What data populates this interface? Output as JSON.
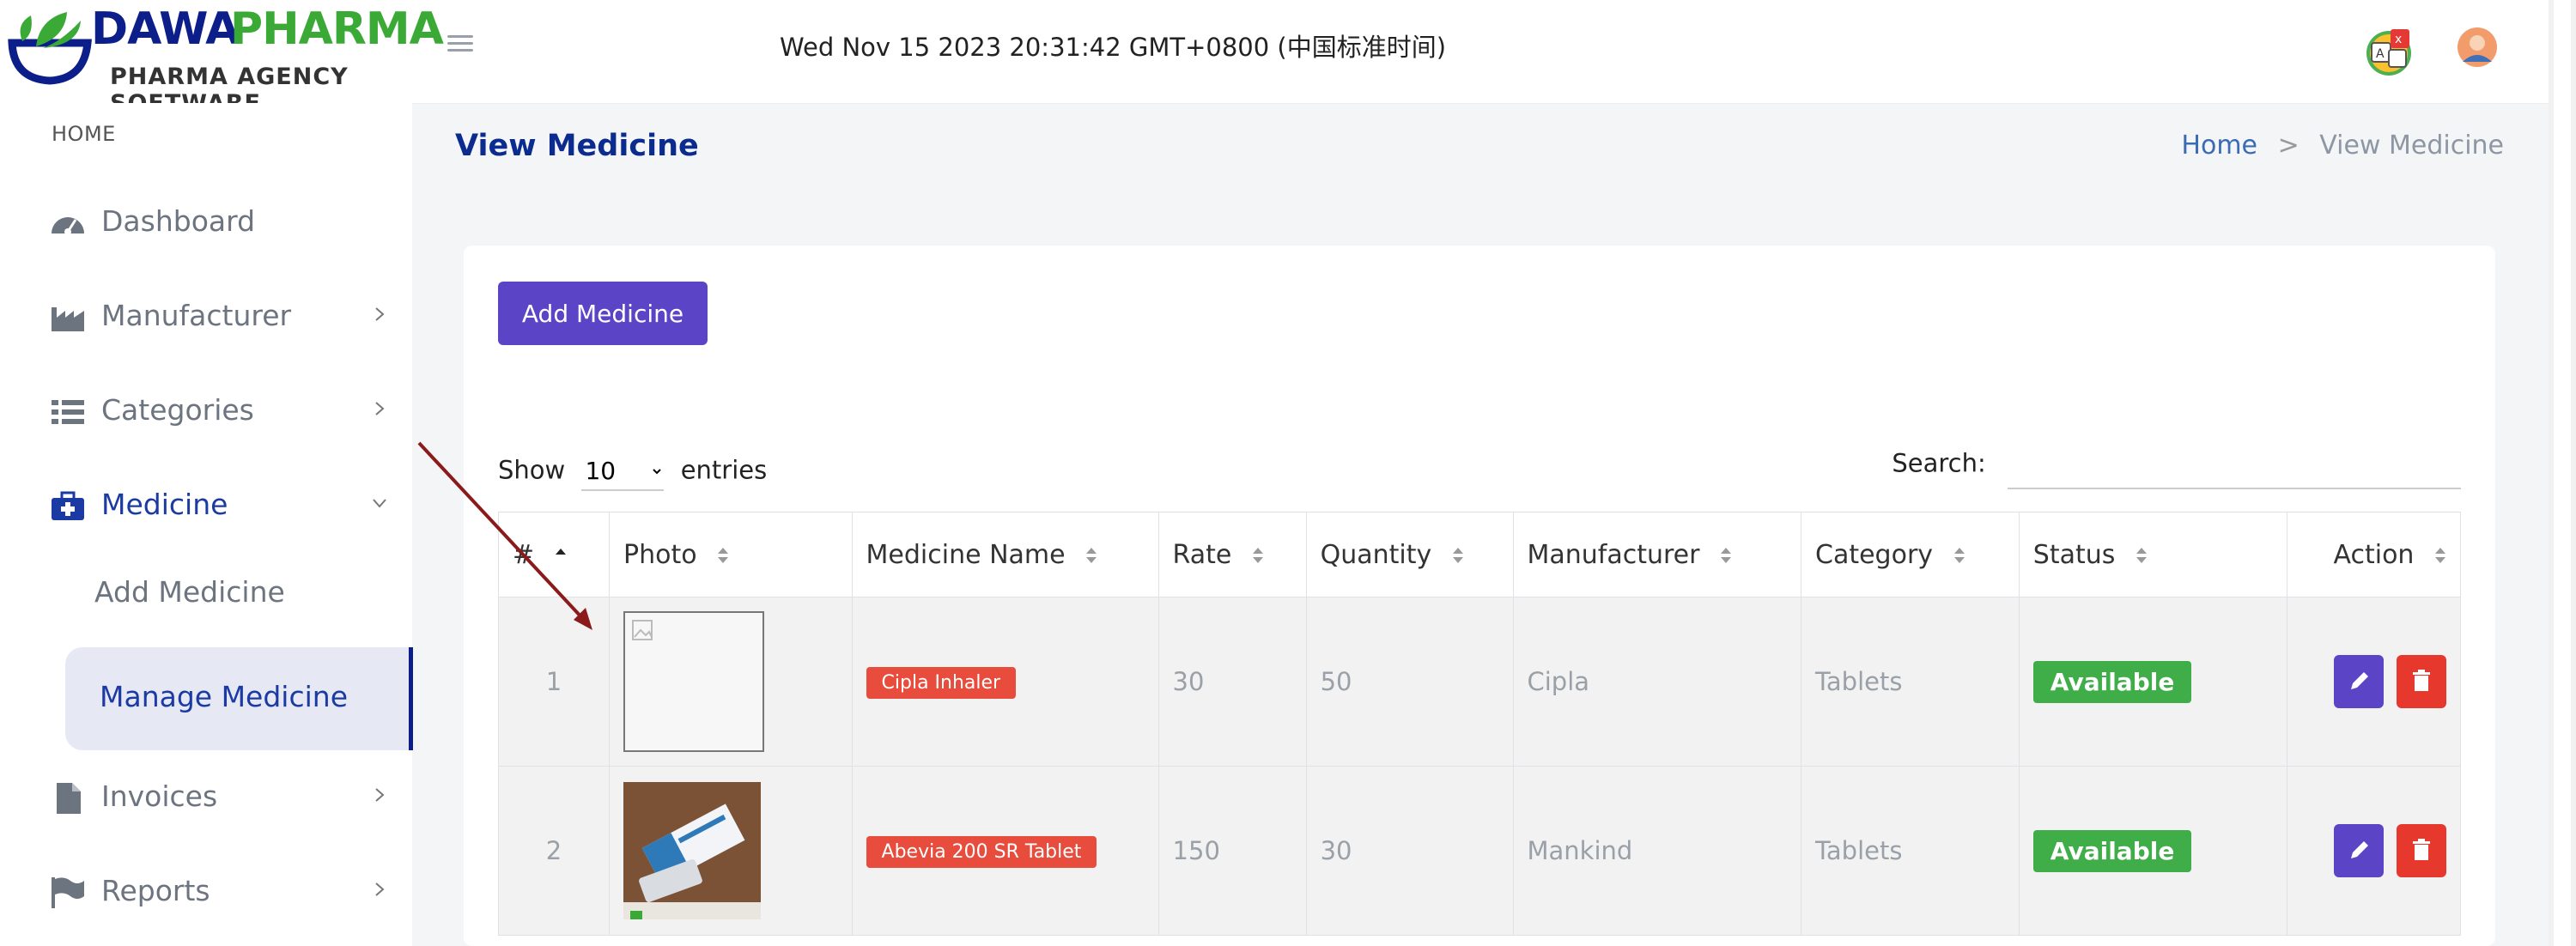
{
  "header": {
    "brand_primary": "DAWA",
    "brand_secondary": "PHARMA",
    "brand_tagline": "PHARMA AGENCY SOFTWARE",
    "datetime": "Wed Nov 15 2023 20:31:42 GMT+0800 (中国标准时间)",
    "menu_icon": "hamburger-icon",
    "language_icon": "translate-icon",
    "avatar_icon": "user-avatar"
  },
  "sidebar": {
    "heading": "HOME",
    "items": [
      {
        "label": "Dashboard",
        "icon": "dashboard-icon"
      },
      {
        "label": "Manufacturer",
        "icon": "factory-icon"
      },
      {
        "label": "Categories",
        "icon": "list-icon"
      },
      {
        "label": "Medicine",
        "icon": "medkit-icon"
      },
      {
        "label": "Invoices",
        "icon": "file-icon"
      },
      {
        "label": "Reports",
        "icon": "flag-icon"
      }
    ],
    "medicine_sub": [
      {
        "label": "Add Medicine"
      },
      {
        "label": "Manage Medicine"
      }
    ]
  },
  "page": {
    "title": "View Medicine",
    "breadcrumb_home": "Home",
    "breadcrumb_sep": ">",
    "breadcrumb_current": "View Medicine"
  },
  "toolbar": {
    "add_label": "Add Medicine",
    "show_label": "Show",
    "entries_value": "10",
    "entries_label": "entries",
    "search_label": "Search:"
  },
  "table": {
    "columns": [
      "#",
      "Photo",
      "Medicine Name",
      "Rate",
      "Quantity",
      "Manufacturer",
      "Category",
      "Status",
      "Action"
    ],
    "rows": [
      {
        "num": "1",
        "name": "Cipla Inhaler",
        "rate": "30",
        "quantity": "50",
        "manufacturer": "Cipla",
        "category": "Tablets",
        "status": "Available"
      },
      {
        "num": "2",
        "name": "Abevia 200 SR Tablet",
        "rate": "150",
        "quantity": "30",
        "manufacturer": "Mankind",
        "category": "Tablets",
        "status": "Available"
      }
    ]
  },
  "colors": {
    "brand_navy": "#0b1e8a",
    "brand_green": "#3aa935",
    "primary_button": "#5b45c6",
    "danger": "#e7382e",
    "success": "#3fae49",
    "annotation_arrow": "#8b1a1a"
  }
}
